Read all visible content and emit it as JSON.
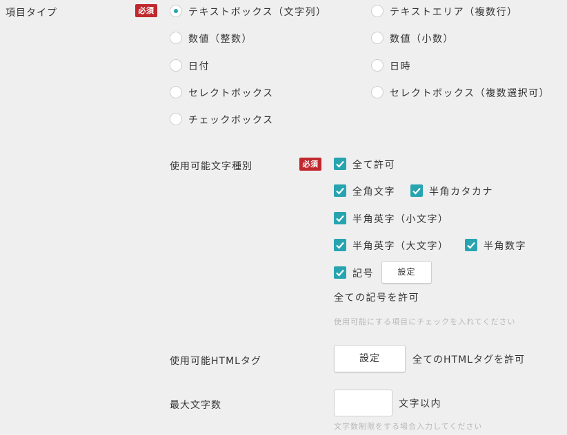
{
  "required_badge": "必須",
  "item_type": {
    "label": "項目タイプ",
    "options": [
      {
        "label": "テキストボックス（文字列）",
        "selected": true
      },
      {
        "label": "テキストエリア（複数行）",
        "selected": false
      },
      {
        "label": "数値（整数）",
        "selected": false
      },
      {
        "label": "数値（小数）",
        "selected": false
      },
      {
        "label": "日付",
        "selected": false
      },
      {
        "label": "日時",
        "selected": false
      },
      {
        "label": "セレクトボックス",
        "selected": false
      },
      {
        "label": "セレクトボックス（複数選択可）",
        "selected": false
      },
      {
        "label": "チェックボックス",
        "selected": false
      }
    ]
  },
  "char_types": {
    "label": "使用可能文字種別",
    "options": [
      {
        "label": "全て許可",
        "checked": true
      },
      {
        "label": "全角文字",
        "checked": true
      },
      {
        "label": "半角カタカナ",
        "checked": true
      },
      {
        "label": "半角英字（小文字）",
        "checked": true
      },
      {
        "label": "半角英字（大文字）",
        "checked": true
      },
      {
        "label": "半角数字",
        "checked": true
      },
      {
        "label": "記号",
        "checked": true
      }
    ],
    "symbol_setting_button": "設定",
    "symbol_status": "全ての記号を許可",
    "hint": "使用可能にする項目にチェックを入れてください"
  },
  "html_tags": {
    "label": "使用可能HTMLタグ",
    "setting_button": "設定",
    "status": "全てのHTMLタグを許可"
  },
  "max_chars": {
    "label": "最大文字数",
    "value": "",
    "unit": "文字以内",
    "hint": "文字数制限をする場合入力してください"
  },
  "colors": {
    "accent": "#27a4b0",
    "required": "#c0282e",
    "background": "#efefef"
  }
}
